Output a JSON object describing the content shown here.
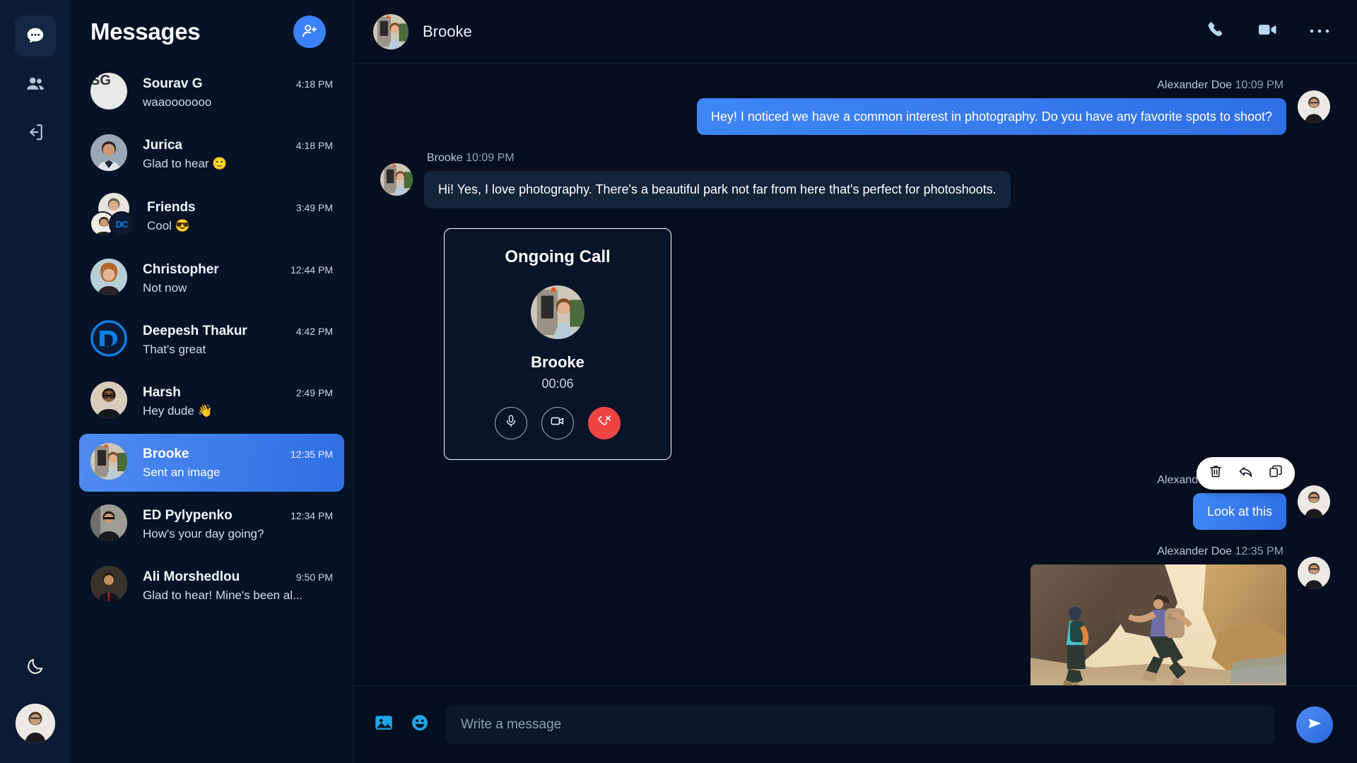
{
  "rail": {
    "items": [
      {
        "name": "chats",
        "icon": "chat-bubble-icon",
        "active": true
      },
      {
        "name": "contacts",
        "icon": "people-icon",
        "active": false
      },
      {
        "name": "logout",
        "icon": "logout-icon",
        "active": false
      }
    ],
    "theme_toggle_icon": "moon-icon",
    "profile_avatar": "user-avatar"
  },
  "sidebar": {
    "title": "Messages",
    "add_button_icon": "add-person-icon",
    "conversations": [
      {
        "name": "Sourav G",
        "time": "4:18 PM",
        "preview": "waaooooooo",
        "avatar": "initials-SG",
        "selected": false,
        "group": false
      },
      {
        "name": "Jurica",
        "time": "4:18 PM",
        "preview": "Glad to hear 🙂",
        "avatar": "photo-man-suit",
        "selected": false,
        "group": false
      },
      {
        "name": "Friends",
        "time": "3:49 PM",
        "preview": "Cool 😎",
        "avatar": "group-avatars",
        "selected": false,
        "group": true
      },
      {
        "name": "Christopher",
        "time": "12:44 PM",
        "preview": "Not now",
        "avatar": "photo-woman-curly",
        "selected": false,
        "group": false
      },
      {
        "name": "Deepesh Thakur",
        "time": "4:42 PM",
        "preview": "That's great",
        "avatar": "dc-logo",
        "selected": false,
        "group": false
      },
      {
        "name": "Harsh",
        "time": "2:49 PM",
        "preview": "Hey dude 👋",
        "avatar": "photo-man-glasses",
        "selected": false,
        "group": false
      },
      {
        "name": "Brooke",
        "time": "12:35 PM",
        "preview": "Sent an image",
        "avatar": "photo-brooke",
        "selected": true,
        "group": false
      },
      {
        "name": "ED Pylypenko",
        "time": "12:34 PM",
        "preview": "How's your day going?",
        "avatar": "photo-man-street",
        "selected": false,
        "group": false
      },
      {
        "name": "Ali Morshedlou",
        "time": "9:50 PM",
        "preview": "Glad to hear! Mine's been al...",
        "avatar": "photo-man-tie",
        "selected": false,
        "group": false
      }
    ]
  },
  "chat_header": {
    "name": "Brooke",
    "avatar": "photo-brooke",
    "actions": [
      {
        "name": "voice-call",
        "icon": "phone-icon"
      },
      {
        "name": "video-call",
        "icon": "video-camera-icon"
      },
      {
        "name": "more-options",
        "icon": "more-horizontal-icon"
      }
    ]
  },
  "messages": [
    {
      "id": "m1",
      "direction": "out",
      "sender": "Alexander Doe",
      "time": "10:09 PM",
      "type": "text",
      "text": "Hey! I noticed we have a common interest in photography. Do you have any favorite spots to shoot?"
    },
    {
      "id": "m2",
      "direction": "in",
      "sender": "Brooke",
      "time": "10:09 PM",
      "type": "text",
      "text": "Hi! Yes, I love photography. There's a beautiful park not far from here that's perfect for photoshoots."
    },
    {
      "id": "m3",
      "direction": "out",
      "sender": "Alexander Doe",
      "time": "12:35 PM",
      "type": "text",
      "text": "Look at this",
      "hovered": true
    },
    {
      "id": "m4",
      "direction": "out",
      "sender": "Alexander Doe",
      "time": "12:35 PM",
      "type": "image",
      "alt": "two hikers walking through a rocky canyon"
    }
  ],
  "hover_actions": [
    {
      "name": "delete-message",
      "icon": "trash-icon"
    },
    {
      "name": "reply-message",
      "icon": "reply-arrow-icon"
    },
    {
      "name": "copy-message",
      "icon": "copy-icon"
    }
  ],
  "call_card": {
    "title": "Ongoing Call",
    "name": "Brooke",
    "duration": "00:06",
    "avatar": "photo-brooke",
    "buttons": [
      {
        "name": "mute-microphone",
        "icon": "microphone-icon",
        "style": "outline"
      },
      {
        "name": "toggle-camera",
        "icon": "video-camera-icon",
        "style": "outline"
      },
      {
        "name": "end-call",
        "icon": "phone-hangup-icon",
        "style": "danger"
      }
    ]
  },
  "composer": {
    "image_icon": "image-icon",
    "emoji_icon": "emoji-smile-icon",
    "placeholder": "Write a message",
    "value": "",
    "send_icon": "send-paper-plane-icon"
  },
  "colors": {
    "accent": "#3b82f6",
    "bubble_out": "#3f86f5",
    "bubble_in": "#132339",
    "danger": "#ef4444",
    "rail_bg": "#0b1b33",
    "list_bg": "#061226",
    "chat_bg": "#050f1f",
    "composer_input": "#0a1828"
  }
}
